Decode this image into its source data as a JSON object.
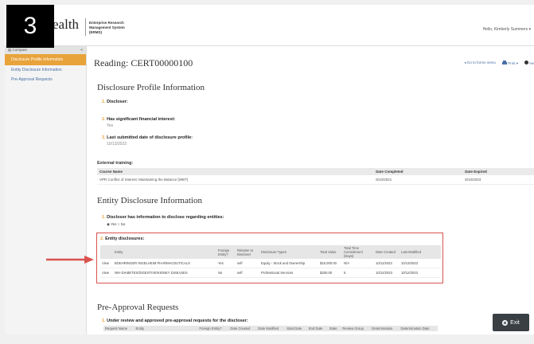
{
  "badge": "3",
  "header": {
    "logo": "ealth",
    "logo_sub": "",
    "system_name": "Enterprise Research Management System (ERMS)",
    "greeting": "Hello, Kimberly Summers ▾"
  },
  "sidebar": {
    "top_label": "▤ Compare",
    "collapse": "«",
    "items": [
      {
        "label": "Disclosure Profile Information"
      },
      {
        "label": "Entity Disclosure Information"
      },
      {
        "label": "Pre-Approval Requests"
      }
    ]
  },
  "main": {
    "reading_title": "Reading: CERT00000100",
    "actions": {
      "goto": "◂ Go to forms menu",
      "print": "Print ▾",
      "help": "He"
    },
    "profile": {
      "title": "Disclosure Profile Information",
      "q1_num": "1.",
      "q1": "Discloser:",
      "q2_num": "2.",
      "q2": "Has significant financial interest:",
      "q2_ans": "Yes",
      "q3_num": "3.",
      "q3": "Last submitted date of disclosure profile:",
      "q3_ans": "10/13/2023"
    },
    "external_training": {
      "title": "External training:",
      "headers": [
        "Course Name",
        "Date Completed",
        "Date Expired"
      ],
      "rows": [
        [
          "VPR Conflict of Interest: Maintaining the Balance [WBT]",
          "8/10/2021",
          "8/10/2023"
        ]
      ]
    },
    "entity": {
      "title": "Entity Disclosure Information",
      "q1_num": "1.",
      "q1": "Discloser has information to disclose regarding entities:",
      "radio_yes": "◉ Yes",
      "radio_no": "○ No",
      "q2_num": "2.",
      "q2": "Entity disclosures:",
      "headers": [
        "",
        "Entity",
        "Foreign Entity?",
        "Relation to Discloser",
        "Disclosure Types",
        "Total Value",
        "Total Time Commitment (Days)",
        "Date Created",
        "Last Modified"
      ],
      "rows": [
        [
          "View",
          "BOEHRINGER INGELHEIM PHARMACEUTICALS",
          "Yes",
          "self",
          "Equity - Stock and Ownership",
          "$15,000.00",
          "N/A",
          "10/11/2023",
          "10/13/2023"
        ],
        [
          "View",
          "NIH-DIABETES/DIGESTIVE/KIDNEY DISEASES",
          "No",
          "self",
          "Professional Services",
          "$250.00",
          "5",
          "10/12/2023",
          "10/12/2023"
        ]
      ]
    },
    "preapproval": {
      "title": "Pre-Approval Requests",
      "q1_num": "1.",
      "q1": "Under review and approved pre-approval requests for the discloser:",
      "headers": [
        "Request Name",
        "Entity",
        "Foreign Entity?",
        "Date Created",
        "Date Modified",
        "Start Date",
        "End Date",
        "State",
        "Review Group",
        "Determination",
        "Determination Date"
      ]
    },
    "exit_label": "Exit"
  },
  "colors": {
    "accent_orange": "#e8a33a",
    "highlight_red": "#d9534f",
    "link_blue": "#4a6fa5",
    "exit_bg": "#3a3f44"
  }
}
